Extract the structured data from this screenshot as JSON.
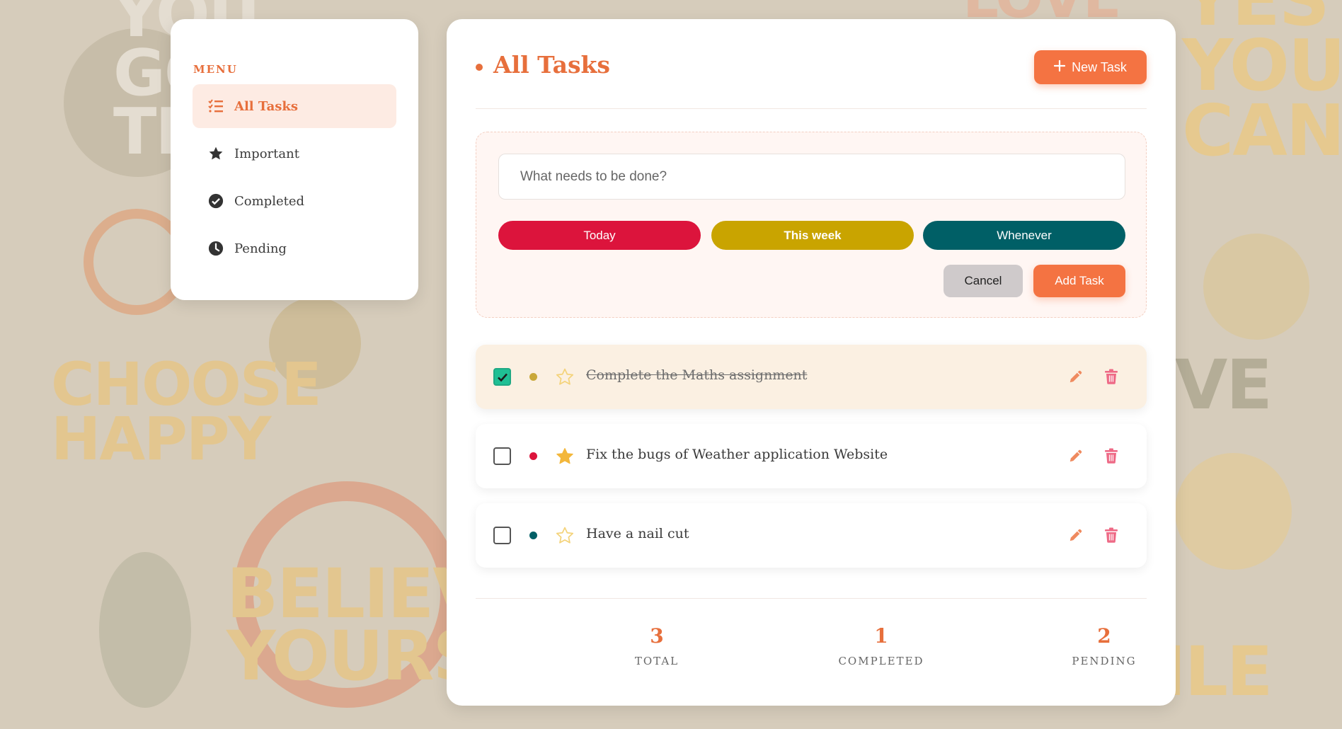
{
  "background": {
    "words": [
      "YOU\nGO\nTH",
      "CHOOSE\nHAPPY",
      "BELIEVE\nYOURSELF",
      "LOVE",
      "YES\nYOU\nCAN",
      "VE",
      "ILE"
    ]
  },
  "sidebar": {
    "heading": "MENU",
    "items": [
      {
        "label": "All Tasks",
        "icon": "list-check-icon",
        "active": true
      },
      {
        "label": "Important",
        "icon": "star-icon",
        "active": false
      },
      {
        "label": "Completed",
        "icon": "check-circle-icon",
        "active": false
      },
      {
        "label": "Pending",
        "icon": "clock-icon",
        "active": false
      }
    ]
  },
  "header": {
    "title": "All Tasks",
    "new_task_label": "New Task",
    "new_task_icon": "plus-icon"
  },
  "form": {
    "input_placeholder": "What needs to be done?",
    "input_value": "",
    "priorities": [
      {
        "label": "Today",
        "color": "#dc143c"
      },
      {
        "label": "This week",
        "color": "#c9a400"
      },
      {
        "label": "Whenever",
        "color": "#005f66"
      }
    ],
    "cancel_label": "Cancel",
    "add_label": "Add Task"
  },
  "tasks": [
    {
      "text": "Complete the Maths assignment",
      "completed": true,
      "important": false,
      "priority_color": "#c9a83a"
    },
    {
      "text": "Fix the bugs of Weather application Website",
      "completed": false,
      "important": true,
      "priority_color": "#dc143c"
    },
    {
      "text": "Have a nail cut",
      "completed": false,
      "important": false,
      "priority_color": "#005f66"
    }
  ],
  "stats": {
    "total": "3",
    "total_label": "TOTAL",
    "completed": "1",
    "completed_label": "COMPLETED",
    "pending": "2",
    "pending_label": "PENDING"
  },
  "colors": {
    "accent": "#e76f3c",
    "button": "#f47342",
    "checkbox_checked": "#1fbf94",
    "star_filled": "#f3b73b",
    "star_outline": "#f4d37a",
    "edit_icon": "#ef8a5f",
    "delete_icon": "#ee6a86"
  }
}
